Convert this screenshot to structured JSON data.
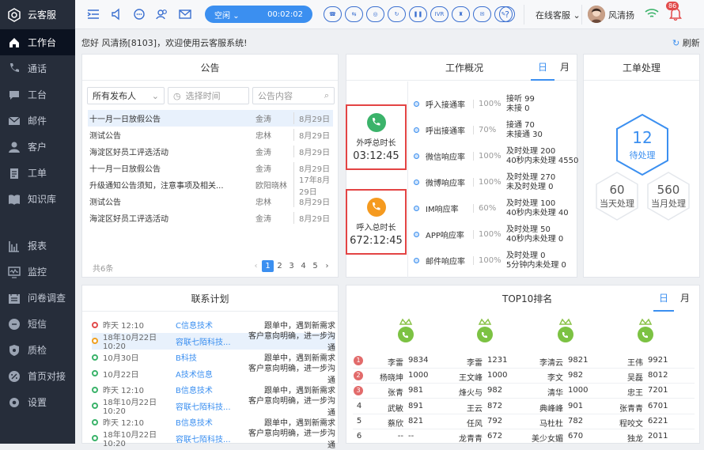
{
  "app": {
    "title": "云客服"
  },
  "sidebar": {
    "items": [
      {
        "label": "工作台",
        "icon": "home-icon",
        "active": true
      },
      {
        "label": "通话",
        "icon": "phone-icon"
      },
      {
        "label": "工台",
        "icon": "chat-icon"
      },
      {
        "label": "邮件",
        "icon": "mail-icon"
      },
      {
        "label": "客户",
        "icon": "user-icon"
      },
      {
        "label": "工单",
        "icon": "clipboard-icon"
      },
      {
        "label": "知识库",
        "icon": "book-icon"
      },
      {
        "label": "报表",
        "icon": "bar-chart-icon"
      },
      {
        "label": "监控",
        "icon": "monitor-icon"
      },
      {
        "label": "问卷调查",
        "icon": "calendar-icon"
      },
      {
        "label": "短信",
        "icon": "message-icon"
      },
      {
        "label": "质检",
        "icon": "shield-icon"
      },
      {
        "label": "首页对接",
        "icon": "link-icon"
      },
      {
        "label": "设置",
        "icon": "gear-icon"
      }
    ]
  },
  "topbar": {
    "status": "空闲",
    "timer": "00:02:02",
    "call_buttons": [
      "hangup",
      "transfer",
      "consult",
      "refresh",
      "pause",
      "IVR",
      "meeting",
      "chat",
      "edit"
    ],
    "online_label": "在线客服",
    "user_name": "风清扬",
    "notification_count": "86"
  },
  "greeting": "您好 风清扬[8103]，欢迎使用云客服系统!",
  "refresh_label": "刷新",
  "notice": {
    "title": "公告",
    "filter_publisher": "所有发布人",
    "filter_time_placeholder": "选择时间",
    "filter_content_placeholder": "公告内容",
    "rows": [
      {
        "title": "十一月一日放假公告",
        "author": "金涛",
        "date": "8月29日"
      },
      {
        "title": "测试公告",
        "author": "忠林",
        "date": "8月29日"
      },
      {
        "title": "海淀区好员工评选活动",
        "author": "金涛",
        "date": "8月29日"
      },
      {
        "title": "十一月一日放假公告",
        "author": "金涛",
        "date": "8月29日"
      },
      {
        "title": "升级通知公告须知，注意事项及相关...",
        "author": "欧阳晓林",
        "date": "17年8月29日"
      },
      {
        "title": "测试公告",
        "author": "忠林",
        "date": "8月29日"
      },
      {
        "title": "海淀区好员工评选活动",
        "author": "金涛",
        "date": "8月29日"
      }
    ],
    "total": "共6条",
    "pages": [
      "1",
      "2",
      "3",
      "4",
      "5"
    ]
  },
  "overview": {
    "title": "工作概况",
    "tab_day": "日",
    "tab_month": "月",
    "outbound_label": "外呼总时长",
    "outbound_value": "03:12:45",
    "inbound_label": "呼入总时长",
    "inbound_value": "672:12:45",
    "rows": [
      {
        "name": "呼入接通率",
        "pct": "100%",
        "l1": "接听 99",
        "l2": "未接 0"
      },
      {
        "name": "呼出接通率",
        "pct": "70%",
        "l1": "接通 70",
        "l2": "未接通 30"
      },
      {
        "name": "微信响应率",
        "pct": "100%",
        "l1": "及时处理 200",
        "l2": "40秒内未处理 4550"
      },
      {
        "name": "微博响应率",
        "pct": "100%",
        "l1": "及时处理 270",
        "l2": "未及时处理 0"
      },
      {
        "name": "IM响应率",
        "pct": "60%",
        "l1": "及时处理 100",
        "l2": "40秒内未处理 40"
      },
      {
        "name": "APP响应率",
        "pct": "100%",
        "l1": "及时处理 50",
        "l2": "40秒内未处理 0"
      },
      {
        "name": "邮件响应率",
        "pct": "100%",
        "l1": "及时处理 0",
        "l2": "5分钟内未处理 0"
      }
    ]
  },
  "ticket": {
    "title": "工单处理",
    "pending_count": "12",
    "pending_label": "待处理",
    "today_count": "60",
    "today_label": "当天处理",
    "month_count": "560",
    "month_label": "当月处理"
  },
  "contact": {
    "title": "联系计划",
    "rows": [
      {
        "time": "昨天 12:10",
        "company": "C信息技术",
        "desc": "跟单中，遇到新需求",
        "status": "red"
      },
      {
        "time": "18年10月22日 10:20",
        "company": "容联七陌科技...",
        "desc": "客户意向明确，进一步沟通",
        "status": "orange"
      },
      {
        "time": "10月30日",
        "company": "B科技",
        "desc": "跟单中，遇到新需求",
        "status": "green"
      },
      {
        "time": "10月22日",
        "company": "A技术信息",
        "desc": "客户意向明确，进一步沟通",
        "status": "green"
      },
      {
        "time": "昨天 12:10",
        "company": "B信息技术",
        "desc": "跟单中，遇到新需求",
        "status": "green"
      },
      {
        "time": "18年10月22日 10:20",
        "company": "容联七陌科技...",
        "desc": "客户意向明确，进一步沟通",
        "status": "green"
      },
      {
        "time": "昨天 12:10",
        "company": "B信息技术",
        "desc": "跟单中，遇到新需求",
        "status": "green"
      },
      {
        "time": "18年10月22日 10:20",
        "company": "容联七陌科技...",
        "desc": "客户意向明确，进一步沟通",
        "status": "green"
      }
    ]
  },
  "top10": {
    "title": "TOP10排名",
    "tab_day": "日",
    "tab_month": "月",
    "columns": [
      {
        "icon": "phone-icon",
        "rows": [
          [
            "李雷",
            "9834"
          ],
          [
            "杨晓坤",
            "1000"
          ],
          [
            "张青",
            "981"
          ],
          [
            "武敏",
            "891"
          ],
          [
            "蔡欣",
            "821"
          ],
          [
            "--",
            "--"
          ]
        ]
      },
      {
        "icon": "mail-icon",
        "rows": [
          [
            "李雷",
            "1231"
          ],
          [
            "王文峰",
            "1000"
          ],
          [
            "烽火与",
            "982"
          ],
          [
            "王云",
            "872"
          ],
          [
            "任风",
            "792"
          ],
          [
            "龙青青",
            "672"
          ]
        ]
      },
      {
        "icon": "chat-icon",
        "rows": [
          [
            "李清云",
            "9821"
          ],
          [
            "李文",
            "982"
          ],
          [
            "清华",
            "1000"
          ],
          [
            "典峰峰",
            "901"
          ],
          [
            "马杜杜",
            "782"
          ],
          [
            "美少女媚",
            "670"
          ]
        ]
      },
      {
        "icon": "ticket-icon",
        "rows": [
          [
            "王伟",
            "9921"
          ],
          [
            "吴磊",
            "8012"
          ],
          [
            "忠王",
            "7201"
          ],
          [
            "张青青",
            "6701"
          ],
          [
            "程咬文",
            "6221"
          ],
          [
            "独龙",
            "2011"
          ]
        ]
      }
    ],
    "ranks": [
      "1",
      "2",
      "3",
      "4",
      "5",
      "6"
    ]
  }
}
